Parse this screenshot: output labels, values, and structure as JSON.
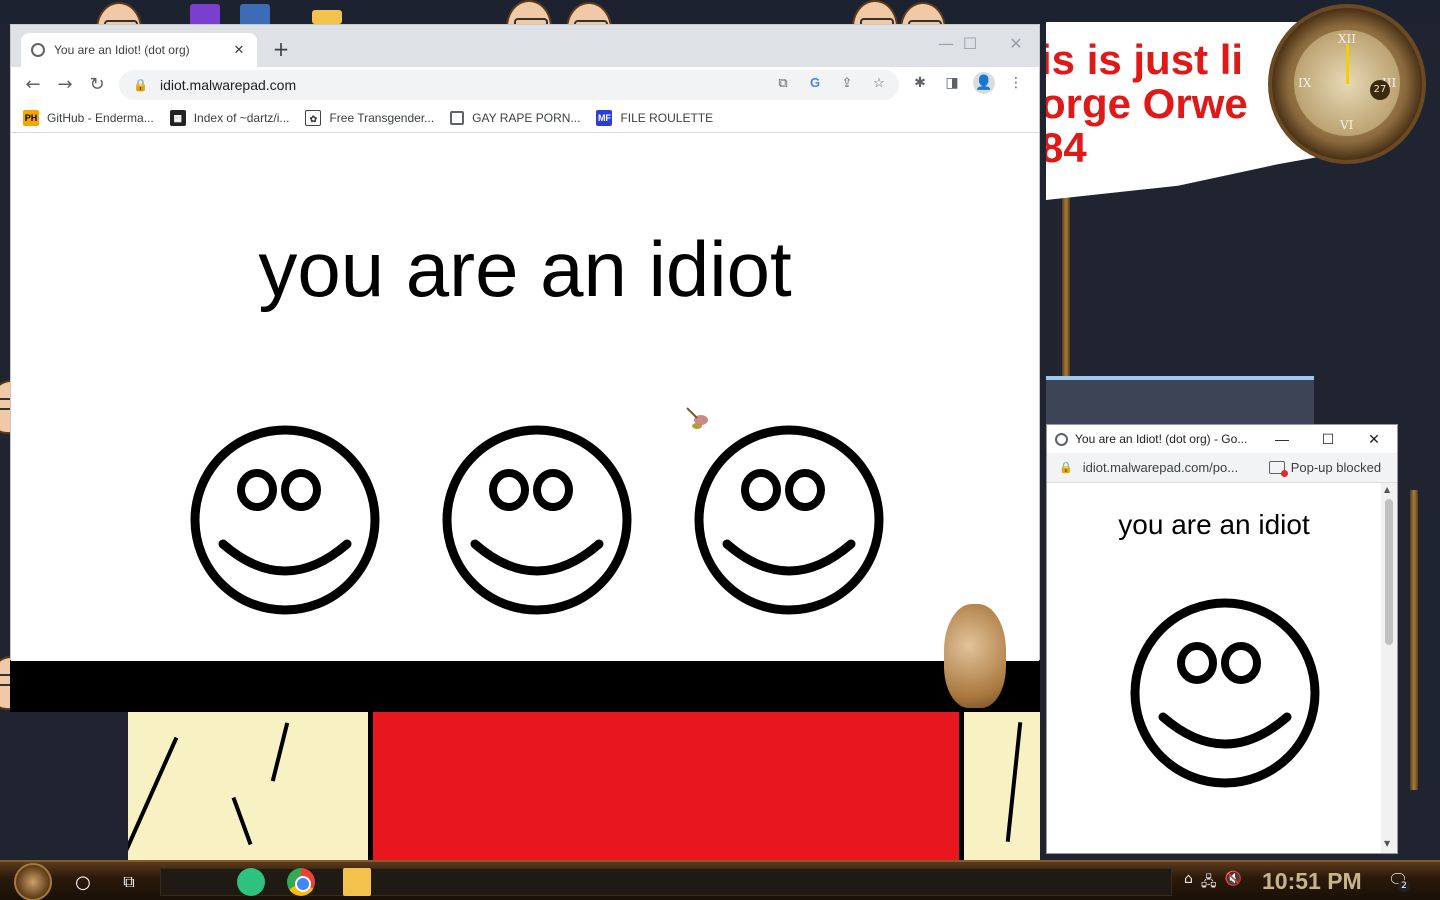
{
  "desktop": {
    "banner_lines": [
      "is is just li",
      "orge Orwe",
      "84"
    ],
    "clock_date": "27",
    "clock_numerals": [
      "XII",
      "III",
      "VI",
      "IX"
    ]
  },
  "main_window": {
    "tab": {
      "title": "You are an Idiot! (dot org)",
      "close": "✕"
    },
    "new_tab": "+",
    "window_buttons": {
      "minimize": "—",
      "maximize": "☐",
      "close": "✕"
    },
    "nav": {
      "back": "←",
      "forward": "→",
      "reload": "↻"
    },
    "address": {
      "lock": "🔒",
      "url": "idiot.malwarepad.com"
    },
    "omni_icons": [
      "⧉",
      "G",
      "⇪",
      "☆"
    ],
    "toolbar_icons": [
      "✱",
      "◨",
      "👤",
      "⋮"
    ],
    "bookmarks": [
      {
        "icon": "PH",
        "label": "GitHub - Enderma..."
      },
      {
        "icon": "▦",
        "label": "Index of ~dartz/i..."
      },
      {
        "icon": "✿",
        "label": "Free Transgender..."
      },
      {
        "icon": "",
        "label": "GAY RAPE PORN..."
      },
      {
        "icon": "MF",
        "label": "FILE ROULETTE"
      }
    ],
    "page": {
      "headline": "you are an idiot",
      "smiley_count": 3
    }
  },
  "popup_window": {
    "title": "You are an Idiot! (dot org) - Go...",
    "window_buttons": {
      "minimize": "—",
      "maximize": "☐",
      "close": "✕"
    },
    "address": {
      "lock": "🔒",
      "url": "idiot.malwarepad.com/po...",
      "blocked_label": "Pop-up blocked"
    },
    "page": {
      "headline": "you are an idiot"
    },
    "scroll": {
      "up": "▲",
      "down": "▼"
    }
  },
  "taskbar": {
    "search_glyph": "○",
    "taskview_glyph": "⧉",
    "apps": [
      "notes-app",
      "chrome",
      "file-explorer"
    ],
    "tray": [
      "⌂",
      "🖧",
      "🔇"
    ],
    "time": "10:51 PM",
    "notifications_count": "2",
    "notifications_glyph": "🗨"
  },
  "colors": {
    "banner_red": "#e01818",
    "scene_red": "#e8171f",
    "scene_cream": "#f8f1c3",
    "taskbar_brown": "#2c1a0a",
    "clock_text": "#c9b38a"
  }
}
